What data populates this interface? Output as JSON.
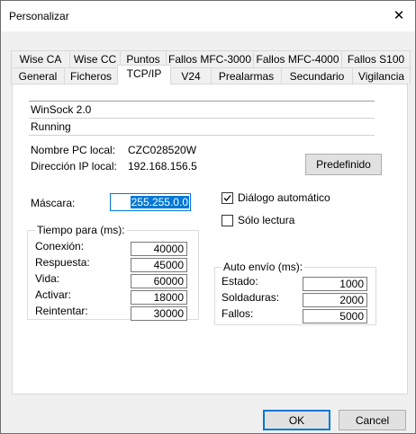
{
  "window": {
    "title": "Personalizar"
  },
  "tabs_row1": [
    "Wise CA",
    "Wise CC",
    "Puntos",
    "Fallos MFC-3000",
    "Fallos MFC-4000",
    "Fallos S100"
  ],
  "tabs_row2": [
    "General",
    "Ficheros",
    "TCP/IP",
    "V24",
    "Prealarmas",
    "Secundario",
    "Vigilancia"
  ],
  "active_tab": "TCP/IP",
  "winsock": {
    "version": "WinSock 2.0",
    "status": "Running"
  },
  "pc": {
    "name_label": "Nombre PC local:",
    "name_value": "CZC028520W",
    "ip_label": "Dirección IP local:",
    "ip_value": "192.168.156.5"
  },
  "buttons": {
    "predefinido": "Predefinido",
    "ok": "OK",
    "cancel": "Cancel"
  },
  "mascara": {
    "label": "Máscara:",
    "value": "255.255.0.0"
  },
  "options": {
    "dialogo_label": "Diálogo automático",
    "dialogo_checked": true,
    "solo_lectura_label": "Sólo lectura",
    "solo_lectura_checked": false
  },
  "tiempo": {
    "label": "Tiempo para (ms):",
    "rows": [
      {
        "label": "Conexión:",
        "value": "40000"
      },
      {
        "label": "Respuesta:",
        "value": "45000"
      },
      {
        "label": "Vida:",
        "value": "60000"
      },
      {
        "label": "Activar:",
        "value": "18000"
      },
      {
        "label": "Reintentar:",
        "value": "30000"
      }
    ]
  },
  "auto_envio": {
    "label": "Auto envío (ms):",
    "rows": [
      {
        "label": "Estado:",
        "value": "1000"
      },
      {
        "label": "Soldaduras:",
        "value": "2000"
      },
      {
        "label": "Fallos:",
        "value": "5000"
      }
    ]
  },
  "colors": {
    "accent": "#0078d7",
    "selection": "#0078d7"
  }
}
